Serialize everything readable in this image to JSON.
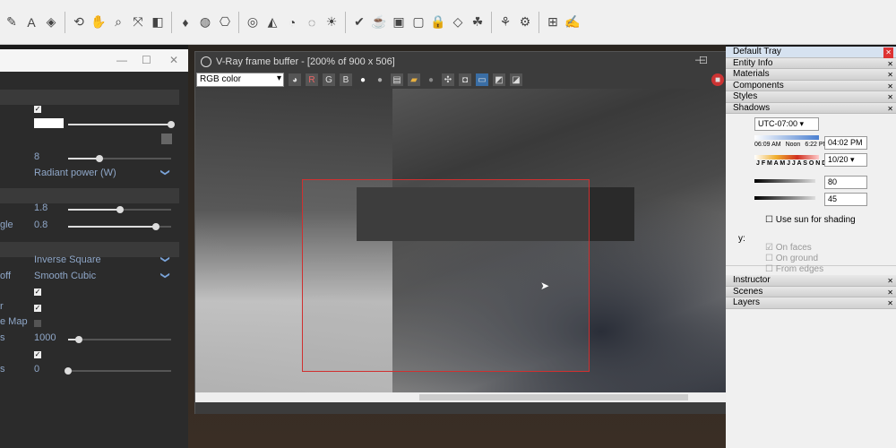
{
  "toolbar": {
    "icons": [
      "pencil-icon",
      "text-icon",
      "paint-bucket-icon",
      "orbit-icon",
      "pan-icon",
      "zoom-icon",
      "zoom-extents-icon",
      "section-icon",
      "ruby-icon",
      "vray-asset-editor-icon",
      "vray-render-icon",
      "vray-interactive-icon",
      "light-icon",
      "sphere-light-icon",
      "dome-light-icon",
      "sun-icon",
      "validate-icon",
      "teapot-icon",
      "proxy-icon",
      "window-icon",
      "lock-icon",
      "mesh-icon",
      "fur-icon",
      "grass-icon",
      "settings-icon",
      "grid-icon",
      "edit-icon"
    ]
  },
  "left_panel": {
    "rows": [
      {
        "label": "",
        "type": "check",
        "checked": true
      },
      {
        "label": "",
        "type": "color-slider",
        "value": 1.0
      },
      {
        "label": "",
        "type": "texture"
      },
      {
        "label": "",
        "value": "8",
        "slider": 0.3
      },
      {
        "label": "",
        "value": "Radiant power (W)",
        "type": "dropdown"
      },
      {
        "label": "",
        "value": "1.8",
        "slider": 0.5
      },
      {
        "label": "gle",
        "value": "0.8",
        "slider": 0.85
      },
      {
        "label": "",
        "value": "Inverse Square",
        "type": "dropdown"
      },
      {
        "label": "off",
        "value": "Smooth Cubic",
        "type": "dropdown"
      },
      {
        "label": "",
        "type": "check",
        "checked": true
      },
      {
        "label": "r",
        "type": "check",
        "checked": true
      },
      {
        "label": "e Map",
        "type": "check",
        "checked": false
      },
      {
        "label": "s",
        "value": "1000",
        "slider": 0.1
      },
      {
        "label": "",
        "type": "check",
        "checked": true
      },
      {
        "label": "s",
        "value": "0",
        "slider": 0.0
      }
    ]
  },
  "vfb": {
    "title": "V-Ray frame buffer - [200% of 900 x 506]",
    "channel": "RGB color",
    "buttons": [
      "R",
      "G",
      "B"
    ],
    "region_color": "#d03030"
  },
  "tray": {
    "title": "Default Tray",
    "panels": [
      "Entity Info",
      "Materials",
      "Components",
      "Styles",
      "Shadows"
    ],
    "timezone": "UTC-07:00",
    "sunrise": "06:09 AM",
    "noon": "Noon",
    "sunset": "6:22 PM",
    "months": "J F M A M J J A S O N D",
    "time": "04:02 PM",
    "date": "10/20",
    "light": "80",
    "dark": "45",
    "use_sun": "Use sun for shading",
    "display_label": "y:",
    "on_faces": "On faces",
    "on_ground": "On ground",
    "from_edges": "From edges",
    "panels_bottom": [
      "Instructor",
      "Scenes",
      "Layers"
    ]
  }
}
